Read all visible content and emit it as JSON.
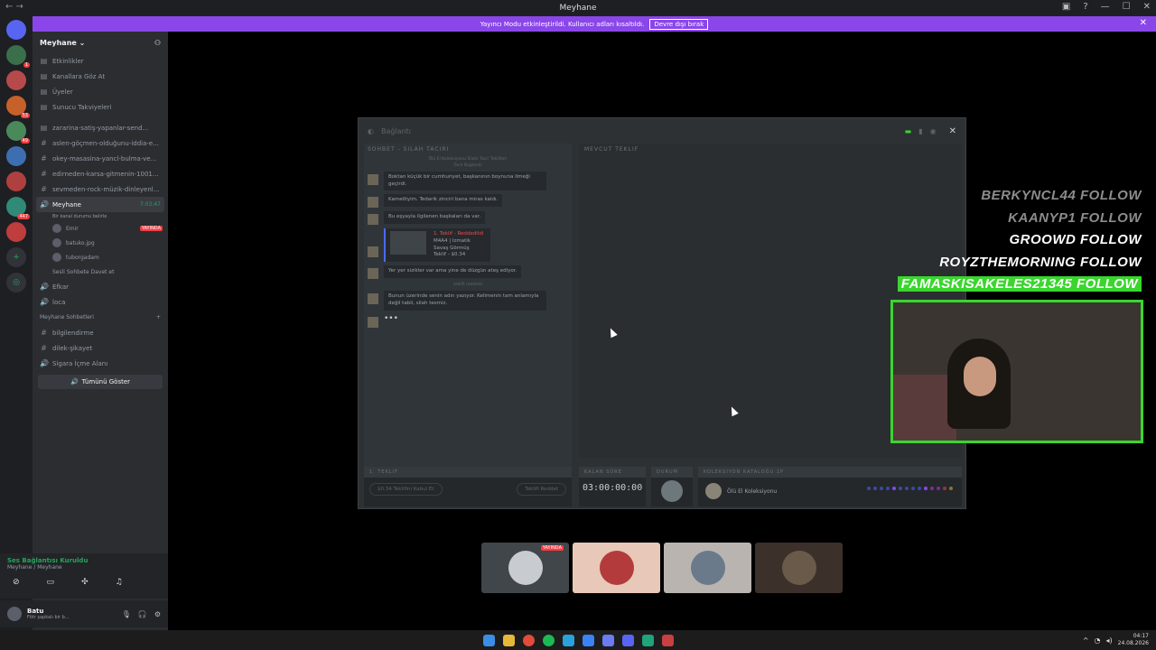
{
  "window": {
    "title": "Meyhane"
  },
  "banner": {
    "text": "Yayıncı Modu etkinleştirildi. Kullanıcı adları kısaltıldı.",
    "button": "Devre dışı bırak"
  },
  "servers": [
    {
      "icon": "discord-icon",
      "badge": ""
    },
    {
      "icon": "server",
      "badge": "1"
    },
    {
      "icon": "server",
      "badge": ""
    },
    {
      "icon": "server",
      "badge": "53"
    },
    {
      "icon": "server",
      "badge": "49"
    },
    {
      "icon": "server",
      "badge": ""
    },
    {
      "icon": "server",
      "badge": ""
    },
    {
      "icon": "server",
      "badge": "447"
    },
    {
      "icon": "server",
      "badge": ""
    }
  ],
  "sidebar": {
    "server_name": "Meyhane",
    "top_items": [
      "Etkinlikler",
      "Kanallara Göz At",
      "Üyeler",
      "Sunucu Takviyeleri"
    ],
    "channels": [
      "zararina-satiş-yapanlar-send...",
      "aslen-göçmen-olduğunu-iddia-e...",
      "okey-masasina-yancl-bulma-ve...",
      "edirneden-karsa-gitmenin-1001...",
      "sevmeden-rock-müzik-dinleyenl..."
    ],
    "voice_active": {
      "name": "Meyhane",
      "time": "7:03:47",
      "status": "Bir kanal durumu belirle"
    },
    "voice_users": [
      {
        "name": "Emir",
        "badge": "YAYINDA"
      },
      {
        "name": "batuko.jpg",
        "badge": ""
      },
      {
        "name": "tuborgadam",
        "badge": ""
      }
    ],
    "invite": "Sesli Sohbete Davet et",
    "more_channels": [
      "Efkar",
      "loca"
    ],
    "category": "Meyhane Sohbetleri",
    "more_text": [
      "bilgilendirme",
      "dilek-şikayet"
    ],
    "smoke": "Sigara İçme Alanı",
    "show_all": "Tümünü Göster"
  },
  "voice_panel": {
    "title": "Ses Bağlantısı Kuruldu",
    "sub": "Meyhane / Meyhane"
  },
  "user_panel": {
    "name": "Batu",
    "status": "Fötr şapkalı bir b..."
  },
  "game": {
    "title": "Bağlantı",
    "left_header": "SOHBET - SILAH TACIRI",
    "sys1": "Ölü El Koleksiyonu Silahı Tacir Teklifleri",
    "sys2": "Tacir Bağlandı",
    "messages": [
      "Boktan küçük bir cumhuriyet, başkanının boynuna ilmeği geçirdi.",
      "Kametliyim. Tedarik zinciri bana miras kaldı.",
      "Bu eşyayla ilgilenen başkaları da var.",
      "Yer yer sizikler var ama yine de düzgün ateş ediyor.",
      "Bunun üzerinde senin adın yazıyor. Kelimenin tam anlamıyla değil tabii, silah tesmiz."
    ],
    "offer_card": [
      "1. Teklif - Reddedildi",
      "M4A4 | Izmatik",
      "Savaş Görmüş",
      "Teklif - $0.34"
    ],
    "sys3": "teklifi reddetti",
    "right_header": "MEVCUT TEKLIF",
    "offer_label": "1. TEKLIF",
    "accept": "$0.34 Teklifini Kabul Et",
    "reject": "Teklifi Reddet",
    "time_label": "KALAN SÜRE",
    "timer": "03:00:00:00",
    "status_label": "DURUM",
    "catalog_label": "KOLEKSIYON KATALOĞU 1P",
    "collection": "Ölü El Koleksiyonu",
    "dots": [
      "#4b69ff",
      "#4b69ff",
      "#4b69ff",
      "#4b69ff",
      "#8847ff",
      "#4b69ff",
      "#4b69ff",
      "#4b69ff",
      "#4b69ff",
      "#8847ff",
      "#d32ce6",
      "#d32ce6",
      "#eb4b4b",
      "#e4ae39"
    ]
  },
  "follows": [
    {
      "text": "BERKYNCL44  FOLLOW",
      "style": "dim"
    },
    {
      "text": "KAANYP1  FOLLOW",
      "style": "dim"
    },
    {
      "text": "GROOWD  FOLLOW",
      "style": "white"
    },
    {
      "text": "ROYZTHEMORNING  FOLLOW",
      "style": "white"
    },
    {
      "text": "FAMASKISAKELES21345  FOLLOW",
      "style": "green"
    }
  ],
  "tiles": [
    {
      "bg": "#40464a",
      "face": "#c8ccd0",
      "badge": "YAYINDA"
    },
    {
      "bg": "#e8c8b8",
      "face": "#b33b3b",
      "badge": ""
    },
    {
      "bg": "#b9b4b0",
      "face": "#6a7a8a",
      "badge": ""
    },
    {
      "bg": "#3c302a",
      "face": "#6a5a4a",
      "badge": ""
    }
  ],
  "clock": {
    "time": "04:17",
    "date": "24.08.2026"
  }
}
